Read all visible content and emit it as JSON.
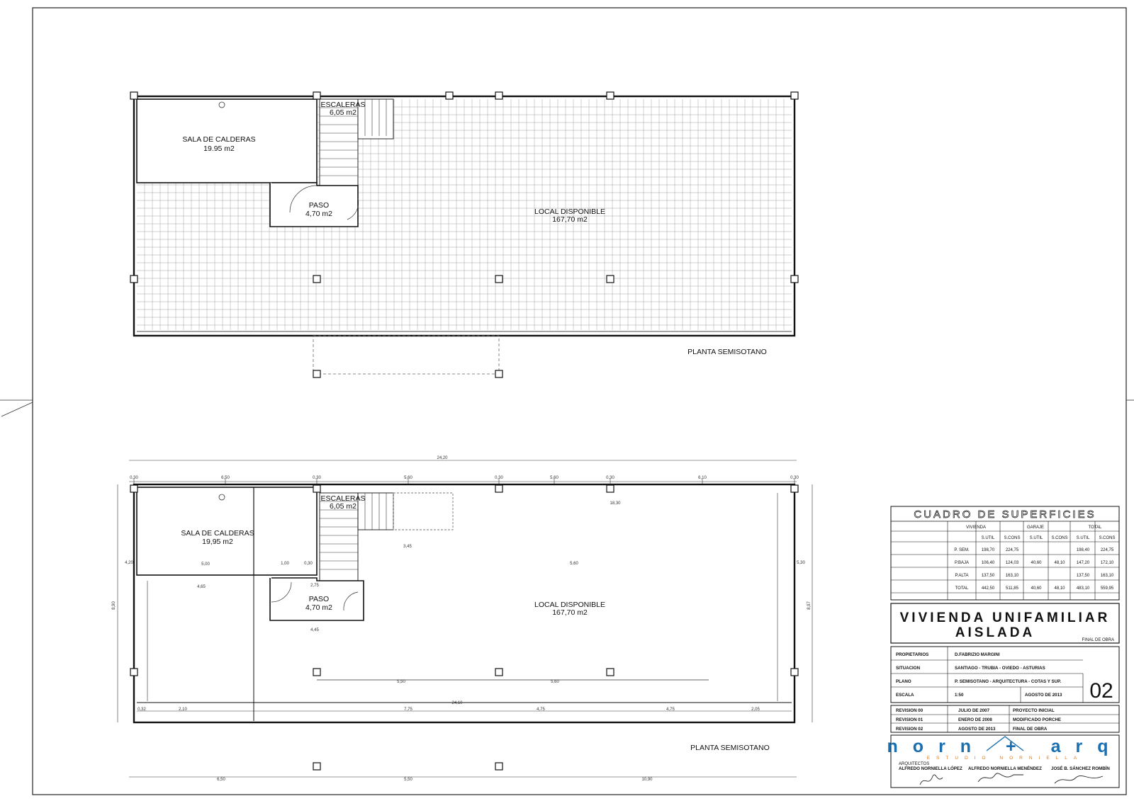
{
  "top_plan": {
    "rooms": {
      "calderas_name": "SALA DE CALDERAS",
      "calderas_area": "19.95 m2",
      "escaleras_name": "ESCALERAS",
      "escaleras_area": "6,05 m2",
      "paso_name": "PASO",
      "paso_area": "4,70 m2",
      "local_name": "LOCAL DISPONIBLE",
      "local_area": "167,70 m2"
    },
    "title": "PLANTA SEMISOTANO"
  },
  "bottom_plan": {
    "rooms": {
      "calderas_name": "SALA DE CALDERAS",
      "calderas_area": "19,95 m2",
      "escaleras_name": "ESCALERAS",
      "escaleras_area": "6,05 m2",
      "paso_name": "PASO",
      "paso_area": "4,70 m2",
      "local_name": "LOCAL DISPONIBLE",
      "local_area": "167,70 m2"
    },
    "title": "PLANTA SEMISOTANO",
    "dims": {
      "overall": "24,20",
      "top_segments": [
        "0,30",
        "6,50",
        "0,30",
        "5,60",
        "0,30",
        "5,60",
        "0,30",
        "6,10",
        "0,30"
      ],
      "inner_top": "18,30",
      "calderas_width": "5,00",
      "left_lower_width": "4,65",
      "paso_widths": [
        "1,00",
        "0,30",
        "2,75"
      ],
      "paso_below": "4,45",
      "escaleras_below": "3,45",
      "local_width": "5,60",
      "bottom_chain": [
        "0,32",
        "2,10",
        "7,75",
        "4,75",
        "4,75",
        "2,05"
      ],
      "bottom_total": "24,10",
      "mid_chain": [
        "5,50",
        "5,60"
      ],
      "lower_segments": [
        "6,50",
        "5,50",
        "10,90"
      ],
      "sides": [
        "8,90",
        "4,20",
        "8,97",
        "5,30"
      ]
    }
  },
  "superficies": {
    "title": "CUADRO DE SUPERFICIES",
    "groups": [
      "VIVIENDA",
      "GARAJE",
      "TOTAL"
    ],
    "subheaders": [
      "S.UTIL",
      "S.CONS",
      "S.UTIL",
      "S.CONS",
      "S.UTIL",
      "S.CONS"
    ],
    "rows": [
      {
        "label": "P. SEM.",
        "values": [
          "198,70",
          "224,75",
          "",
          "",
          "198,40",
          "224,75"
        ]
      },
      {
        "label": "P.BAJA",
        "values": [
          "106,40",
          "124,03",
          "40,60",
          "48,10",
          "147,20",
          "172,10"
        ]
      },
      {
        "label": "P.ALTA",
        "values": [
          "137,50",
          "163,10",
          "",
          "",
          "137,50",
          "163,10"
        ]
      },
      {
        "label": "TOTAL",
        "values": [
          "442,50",
          "511,85",
          "40,60",
          "48,10",
          "483,10",
          "559,95"
        ]
      }
    ]
  },
  "project": {
    "title_line1": "VIVIENDA UNIFAMILIAR",
    "title_line2": "AISLADA",
    "status": "FINAL DE OBRA",
    "fields": [
      {
        "label": "PROPIETARIOS",
        "value": "D.FABRIZIO MARGINI"
      },
      {
        "label": "SITUACION",
        "value": "SANTIAGO - TRUBIA - OVIEDO - ASTURIAS"
      },
      {
        "label": "PLANO",
        "value": "P. SEMISOTANO - ARQUITECTURA - COTAS Y SUP."
      },
      {
        "label": "ESCALA",
        "value": "1:50"
      }
    ],
    "date": "AGOSTO DE 2013",
    "sheet_number": "02",
    "revisions": [
      {
        "rev": "REVISION 00",
        "date": "JULIO DE 2007",
        "desc": "PROYECTO INICIAL"
      },
      {
        "rev": "REVISION 01",
        "date": "ENERO DE 2008",
        "desc": "MODIFICADO PORCHE"
      },
      {
        "rev": "REVISION 02",
        "date": "AGOSTO DE 2013",
        "desc": "FINAL DE OBRA"
      }
    ]
  },
  "studio": {
    "logo_text": "norn + arq",
    "logo_sub": "ESTUDIO NORNIELLA",
    "role": "ARQUITECTOS",
    "architects": [
      "ALFREDO NORNIELLA LÓPEZ",
      "ALFREDO NORNIELLA MENÉNDEZ",
      "JOSÉ B. SÁNCHEZ ROMBÍN"
    ]
  }
}
